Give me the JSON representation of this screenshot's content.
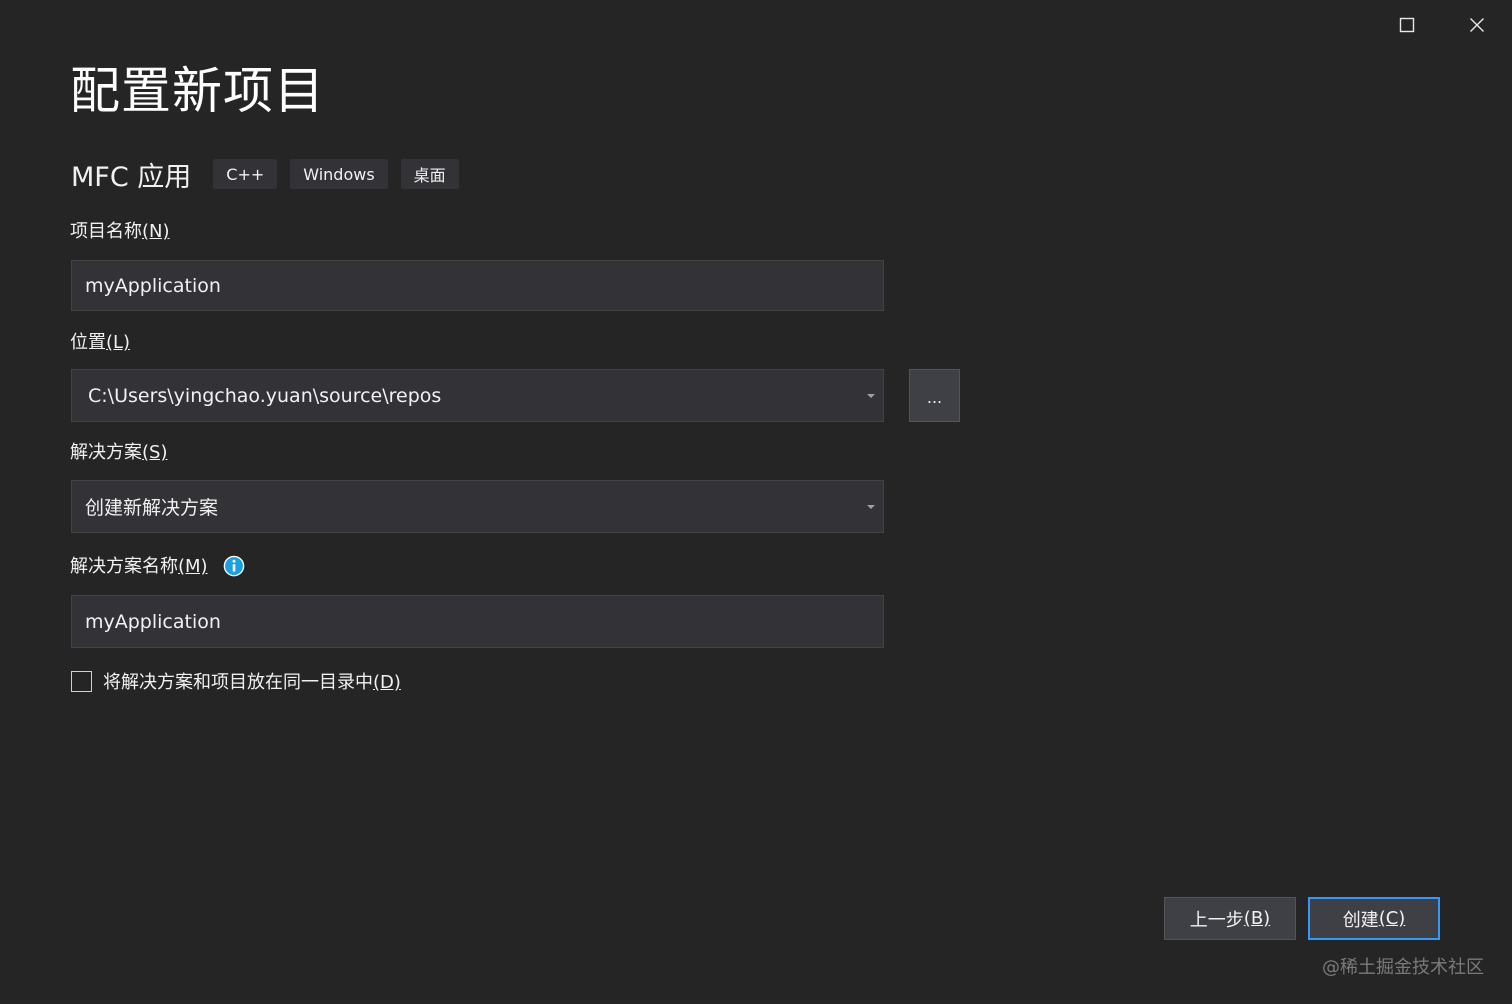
{
  "window": {
    "maximize_icon": "maximize-icon",
    "close_icon": "close-icon"
  },
  "page": {
    "title": "配置新项目"
  },
  "template": {
    "name": "MFC 应用",
    "tags": [
      "C++",
      "Windows",
      "桌面"
    ]
  },
  "fields": {
    "project_name": {
      "label": "项目名称",
      "accel": "(N)",
      "value": "myApplication"
    },
    "location": {
      "label": "位置",
      "accel": "(L)",
      "value": "C:\\Users\\yingchao.yuan\\source\\repos",
      "browse_label": "..."
    },
    "solution": {
      "label": "解决方案",
      "accel": "(S)",
      "value": "创建新解决方案"
    },
    "solution_name": {
      "label": "解决方案名称",
      "accel": "(M)",
      "value": "myApplication",
      "info_icon": "info-icon"
    }
  },
  "checkbox": {
    "label": "将解决方案和项目放在同一目录中",
    "accel": "(D)",
    "checked": false
  },
  "buttons": {
    "back": "上一步",
    "back_accel": "(B)",
    "create": "创建",
    "create_accel": "(C)"
  },
  "watermark": "@稀土掘金技术社区",
  "colors": {
    "background": "#252526",
    "input_bg": "#333337",
    "accent": "#3399ff",
    "info_blue": "#1ba1e2"
  }
}
